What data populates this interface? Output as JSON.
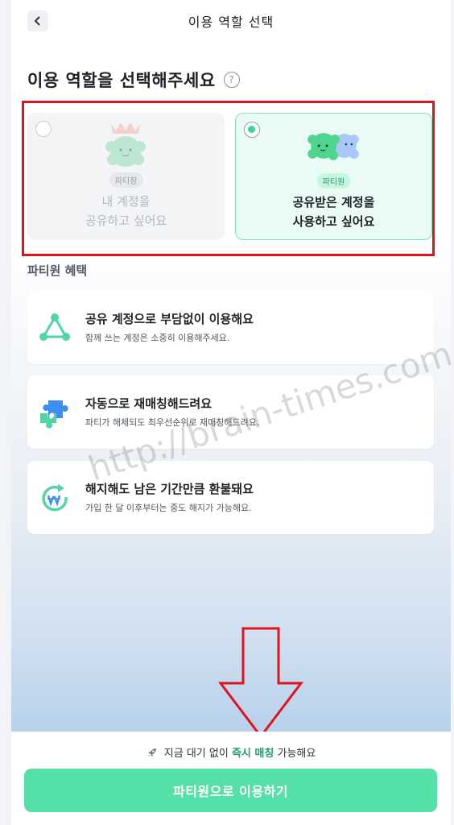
{
  "header": {
    "title": "이용 역할 선택",
    "back_icon": "chevron-left-icon"
  },
  "heading": {
    "text": "이용 역할을 선택해주세요",
    "help_icon": "?"
  },
  "roles": [
    {
      "badge": "파티장",
      "line1": "내 계정을",
      "line2": "공유하고 싶어요",
      "selected": false
    },
    {
      "badge": "파티원",
      "line1": "공유받은 계정을",
      "line2": "사용하고 싶어요",
      "selected": true
    }
  ],
  "benefits_title": "파티원 혜택",
  "benefits": [
    {
      "icon": "share-network-icon",
      "title": "공유 계정으로 부담없이 이용해요",
      "subtitle": "함께 쓰는 계정은 소중히 이용해주세요."
    },
    {
      "icon": "puzzle-icon",
      "title": "자동으로 재매칭해드려요",
      "subtitle": "파티가 해체되도 최우선순위로 재매칭해드려요."
    },
    {
      "icon": "refund-cycle-icon",
      "title": "해지해도 남은 기간만큼 환불돼요",
      "subtitle": "가입 한 달 이후부터는 중도 해지가 가능해요."
    }
  ],
  "watermark": "http://brain-times.com/",
  "footer": {
    "note_prefix": "지금 대기 없이",
    "note_highlight": "즉시 매칭",
    "note_suffix": "가능해요",
    "cta_label": "파티원으로 이용하기"
  },
  "colors": {
    "accent": "#55e0a8",
    "accent_dark": "#1d9e6e",
    "annotation_red": "#e0141e"
  }
}
